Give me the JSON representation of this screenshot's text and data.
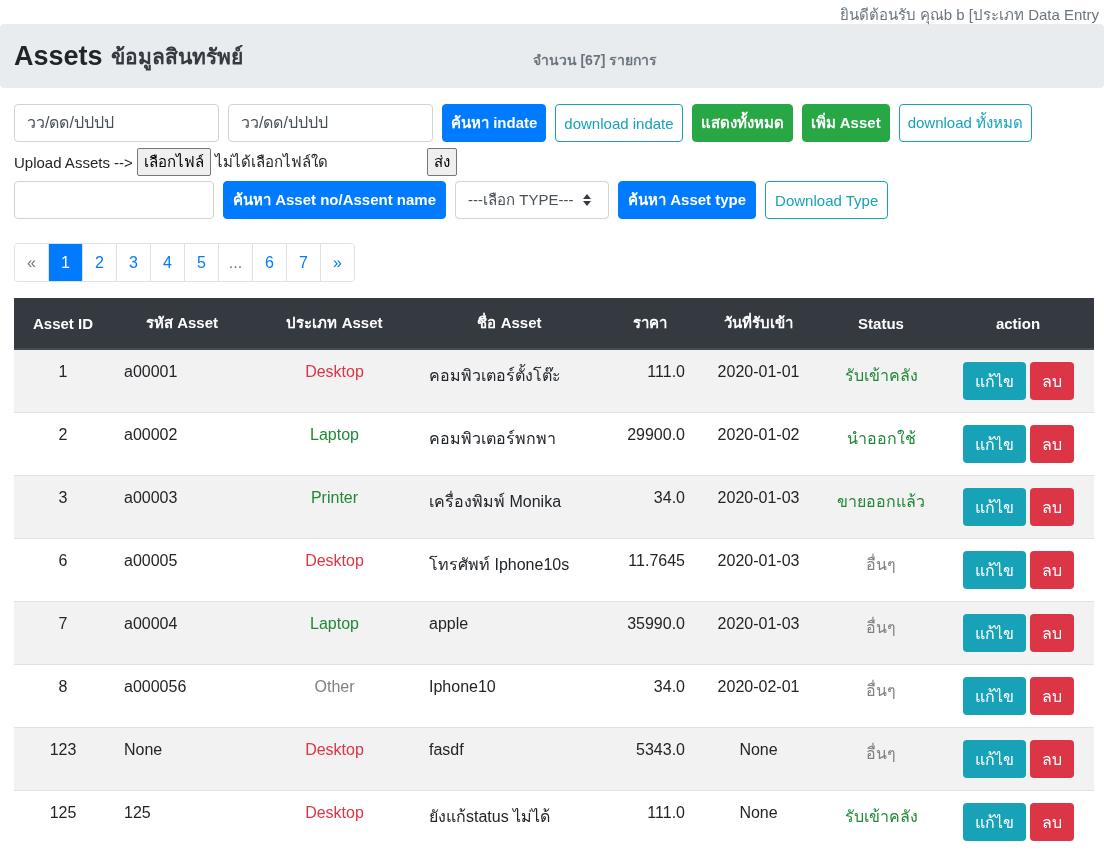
{
  "welcome": "ยินดีต้อนรับ คุณb b [ประเภท Data Entry",
  "header": {
    "title": "Assets",
    "subtitle": "ข้อมูลสินทรัพย์",
    "count": "จำนวน [67] รายการ"
  },
  "filter_rows": [
    [
      {
        "kind": "input",
        "placeholder": "วว/ดด/ปปปป"
      },
      {
        "kind": "input",
        "placeholder": "วว/ดด/ปปปป"
      },
      {
        "kind": "primary",
        "label": "ค้นหา indate"
      },
      {
        "kind": "outline",
        "label": "download indate"
      },
      {
        "kind": "success",
        "label": "แสดงทั้งหมด"
      },
      {
        "kind": "success",
        "label": "เพิ่ม Asset"
      },
      {
        "kind": "outline",
        "label": "download ทั้งหมด"
      }
    ],
    [
      {
        "kind": "text",
        "label": "Upload Assets -->"
      },
      {
        "kind": "file",
        "label": "เลือกไฟล์"
      },
      {
        "kind": "text",
        "label": "ไม่ได้เลือกไฟล์ใด"
      },
      {
        "kind": "submit",
        "label": "ส่ง"
      }
    ],
    [
      {
        "kind": "input"
      },
      {
        "kind": "primary",
        "label": "ค้นหา Asset no/Assent name"
      },
      {
        "kind": "select",
        "label": "---เลือก TYPE---"
      },
      {
        "kind": "primary",
        "label": "ค้นหา Asset type"
      },
      {
        "kind": "outline",
        "label": "Download Type"
      }
    ]
  ],
  "pagination": [
    {
      "label": "«",
      "selected": false,
      "disabled": true
    },
    {
      "label": "1",
      "selected": true,
      "disabled": false
    },
    {
      "label": "2",
      "selected": false,
      "disabled": false
    },
    {
      "label": "3",
      "selected": false,
      "disabled": false
    },
    {
      "label": "4",
      "selected": false,
      "disabled": false
    },
    {
      "label": "5",
      "selected": false,
      "disabled": false
    },
    {
      "label": "...",
      "selected": false,
      "disabled": true
    },
    {
      "label": "6",
      "selected": false,
      "disabled": false
    },
    {
      "label": "7",
      "selected": false,
      "disabled": false
    },
    {
      "label": "»",
      "selected": false,
      "disabled": false
    }
  ],
  "table": {
    "columns": [
      "Asset ID",
      "รหัส Asset",
      "ประเภท Asset",
      "ชื่อ Asset",
      "ราคา",
      "วันที่รับเข้า",
      "Status",
      "action"
    ],
    "rows": [
      {
        "id": "1",
        "code": "a00001",
        "type": {
          "text": "Desktop",
          "color": "#dc3545"
        },
        "name": "คอมพิวเตอร์ตั้งโต๊ะ",
        "price": "111.0",
        "date": "2020-01-01",
        "status": {
          "text": "รับเข้าคลัง",
          "color": "#218838"
        },
        "actions": [
          {
            "kind": "edit",
            "label": "แก้ไข"
          },
          {
            "kind": "delete",
            "label": "ลบ"
          }
        ]
      },
      {
        "id": "2",
        "code": "a00002",
        "type": {
          "text": "Laptop",
          "color": "#218838"
        },
        "name": "คอมพิวเตอร์พกพา",
        "price": "29900.0",
        "date": "2020-01-02",
        "status": {
          "text": "นำออกใช้",
          "color": "#218838"
        },
        "actions": [
          {
            "kind": "edit",
            "label": "แก้ไข"
          },
          {
            "kind": "delete",
            "label": "ลบ"
          }
        ]
      },
      {
        "id": "3",
        "code": "a00003",
        "type": {
          "text": "Printer",
          "color": "#218838"
        },
        "name": "เครื่องพิมพ์ Monika",
        "price": "34.0",
        "date": "2020-01-03",
        "status": {
          "text": "ขายออกแล้ว",
          "color": "#218838"
        },
        "actions": [
          {
            "kind": "edit",
            "label": "แก้ไข"
          },
          {
            "kind": "delete",
            "label": "ลบ"
          }
        ]
      },
      {
        "id": "6",
        "code": "a00005",
        "type": {
          "text": "Desktop",
          "color": "#dc3545"
        },
        "name": "โทรศัพท์ Iphone10s",
        "price": "11.7645",
        "date": "2020-01-03",
        "status": {
          "text": "อื่นๆ",
          "color": "#808080"
        },
        "actions": [
          {
            "kind": "edit",
            "label": "แก้ไข"
          },
          {
            "kind": "delete",
            "label": "ลบ"
          }
        ]
      },
      {
        "id": "7",
        "code": "a00004",
        "type": {
          "text": "Laptop",
          "color": "#218838"
        },
        "name": "apple",
        "price": "35990.0",
        "date": "2020-01-03",
        "status": {
          "text": "อื่นๆ",
          "color": "#808080"
        },
        "actions": [
          {
            "kind": "edit",
            "label": "แก้ไข"
          },
          {
            "kind": "delete",
            "label": "ลบ"
          }
        ]
      },
      {
        "id": "8",
        "code": "a000056",
        "type": {
          "text": "Other",
          "color": "#808080"
        },
        "name": "Iphone10",
        "price": "34.0",
        "date": "2020-02-01",
        "status": {
          "text": "อื่นๆ",
          "color": "#808080"
        },
        "actions": [
          {
            "kind": "edit",
            "label": "แก้ไข"
          },
          {
            "kind": "delete",
            "label": "ลบ"
          }
        ]
      },
      {
        "id": "123",
        "code": "None",
        "type": {
          "text": "Desktop",
          "color": "#dc3545"
        },
        "name": "fasdf",
        "price": "5343.0",
        "date": "None",
        "status": {
          "text": "อื่นๆ",
          "color": "#808080"
        },
        "actions": [
          {
            "kind": "edit",
            "label": "แก้ไข"
          },
          {
            "kind": "delete",
            "label": "ลบ"
          }
        ]
      },
      {
        "id": "125",
        "code": "125",
        "type": {
          "text": "Desktop",
          "color": "#dc3545"
        },
        "name": "ยังแก้status ไม่ได้",
        "price": "111.0",
        "date": "None",
        "status": {
          "text": "รับเข้าคลัง",
          "color": "#218838"
        },
        "actions": [
          {
            "kind": "edit",
            "label": "แก้ไข"
          },
          {
            "kind": "delete",
            "label": "ลบ"
          }
        ]
      }
    ]
  }
}
